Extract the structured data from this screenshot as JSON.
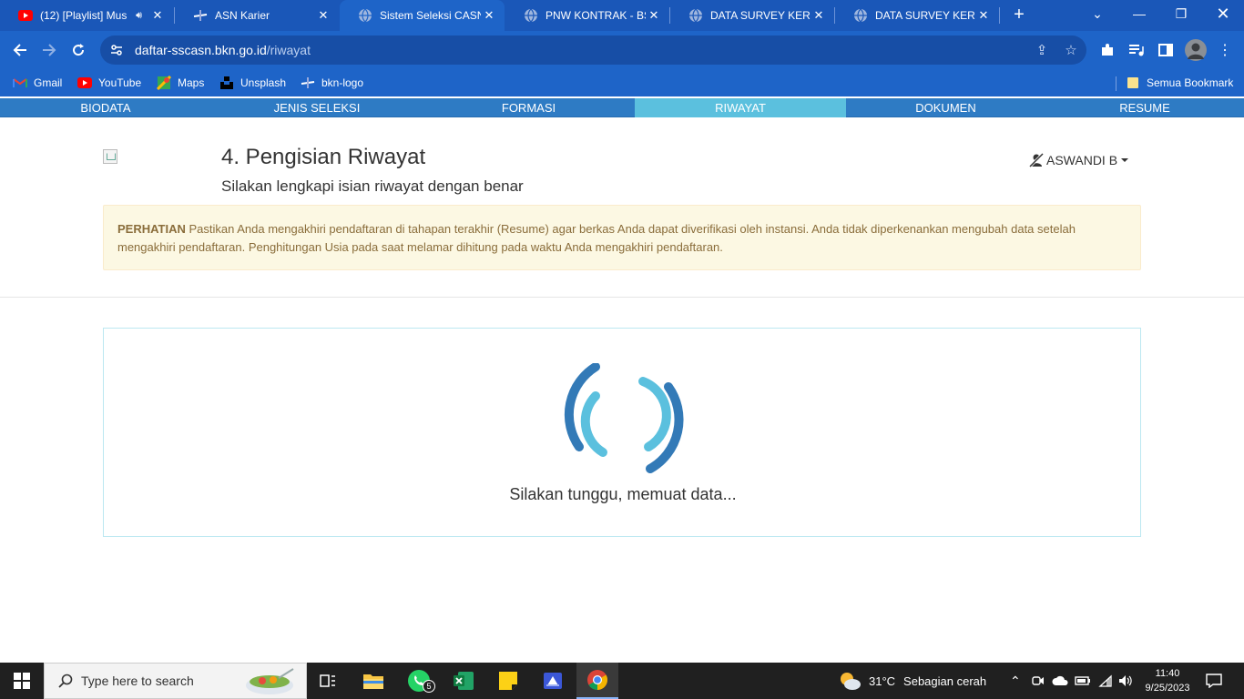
{
  "browser": {
    "tabs": [
      {
        "title": "(12) [Playlist] Mus",
        "icon": "youtube-icon"
      },
      {
        "title": "ASN Karier",
        "icon": "bkn-icon"
      },
      {
        "title": "Sistem Seleksi CASN",
        "icon": "globe-icon"
      },
      {
        "title": "PNW KONTRAK - BSI",
        "icon": "globe-icon"
      },
      {
        "title": "DATA SURVEY KERUS",
        "icon": "globe-icon"
      },
      {
        "title": "DATA SURVEY KERUS",
        "icon": "globe-icon"
      }
    ],
    "url_host": "daftar-sscasn.bkn.go.id",
    "url_path": "/riwayat",
    "bookmarks": [
      {
        "label": "Gmail"
      },
      {
        "label": "YouTube"
      },
      {
        "label": "Maps"
      },
      {
        "label": "Unsplash"
      },
      {
        "label": "bkn-logo"
      }
    ],
    "all_bookmarks": "Semua Bookmark"
  },
  "steps": [
    {
      "label": "BIODATA"
    },
    {
      "label": "JENIS SELEKSI"
    },
    {
      "label": "FORMASI"
    },
    {
      "label": "RIWAYAT"
    },
    {
      "label": "DOKUMEN"
    },
    {
      "label": "RESUME"
    }
  ],
  "header": {
    "title": "4. Pengisian Riwayat",
    "subtitle": "Silakan lengkapi isian riwayat dengan benar",
    "user_name": "ASWANDI B"
  },
  "alert": {
    "strong": "PERHATIAN",
    "text": " Pastikan Anda mengakhiri pendaftaran di tahapan terakhir (Resume) agar berkas Anda dapat diverifikasi oleh instansi. Anda tidak diperkenankan mengubah data setelah mengakhiri pendaftaran. Penghitungan Usia pada saat melamar dihitung pada waktu Anda mengakhiri pendaftaran."
  },
  "loader": {
    "text": "Silakan tunggu, memuat data..."
  },
  "taskbar": {
    "search_placeholder": "Type here to search",
    "whatsapp_badge": "5",
    "weather_temp": "31°C",
    "weather_desc": "Sebagian cerah",
    "time": "11:40",
    "date": "9/25/2023"
  },
  "colors": {
    "stepbar": "#2e7bc4",
    "step_active": "#5bc0de",
    "spinner_dark": "#337ab7",
    "spinner_light": "#5bc0de"
  }
}
